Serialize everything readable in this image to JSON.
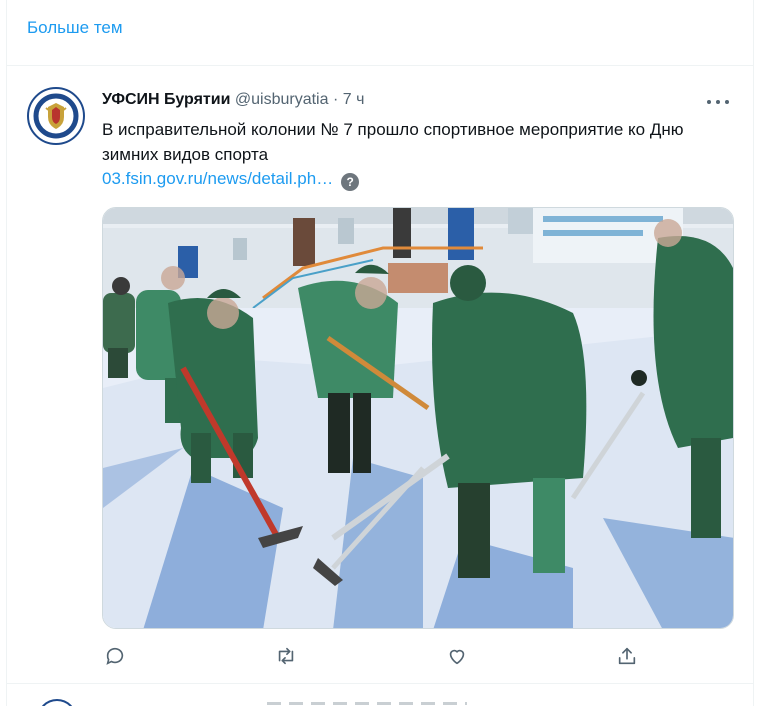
{
  "more_topics": {
    "label": "Больше тем"
  },
  "tweet": {
    "author_name": "УФСИН Бурятии",
    "author_handle": "@uisburyatia",
    "separator": "·",
    "time": "7 ч",
    "text": "В исправительной колонии № 7 прошло спортивное мероприятие ко Дню зимних видов спорта",
    "link": "03.fsin.gov.ru/news/detail.ph…",
    "help_glyph": "?",
    "avatar_icon": "fsin-emblem-icon",
    "image_alt": "Осуждённые в зелёной форме играют в хоккей на снегу во дворе колонии",
    "actions": [
      "reply-icon",
      "retweet-icon",
      "like-icon",
      "share-icon"
    ]
  },
  "colors": {
    "accent": "#1d9bf0",
    "secondary_text": "#536471",
    "uniform_green": "#2f6e4e",
    "snow": "#e8eef8"
  }
}
